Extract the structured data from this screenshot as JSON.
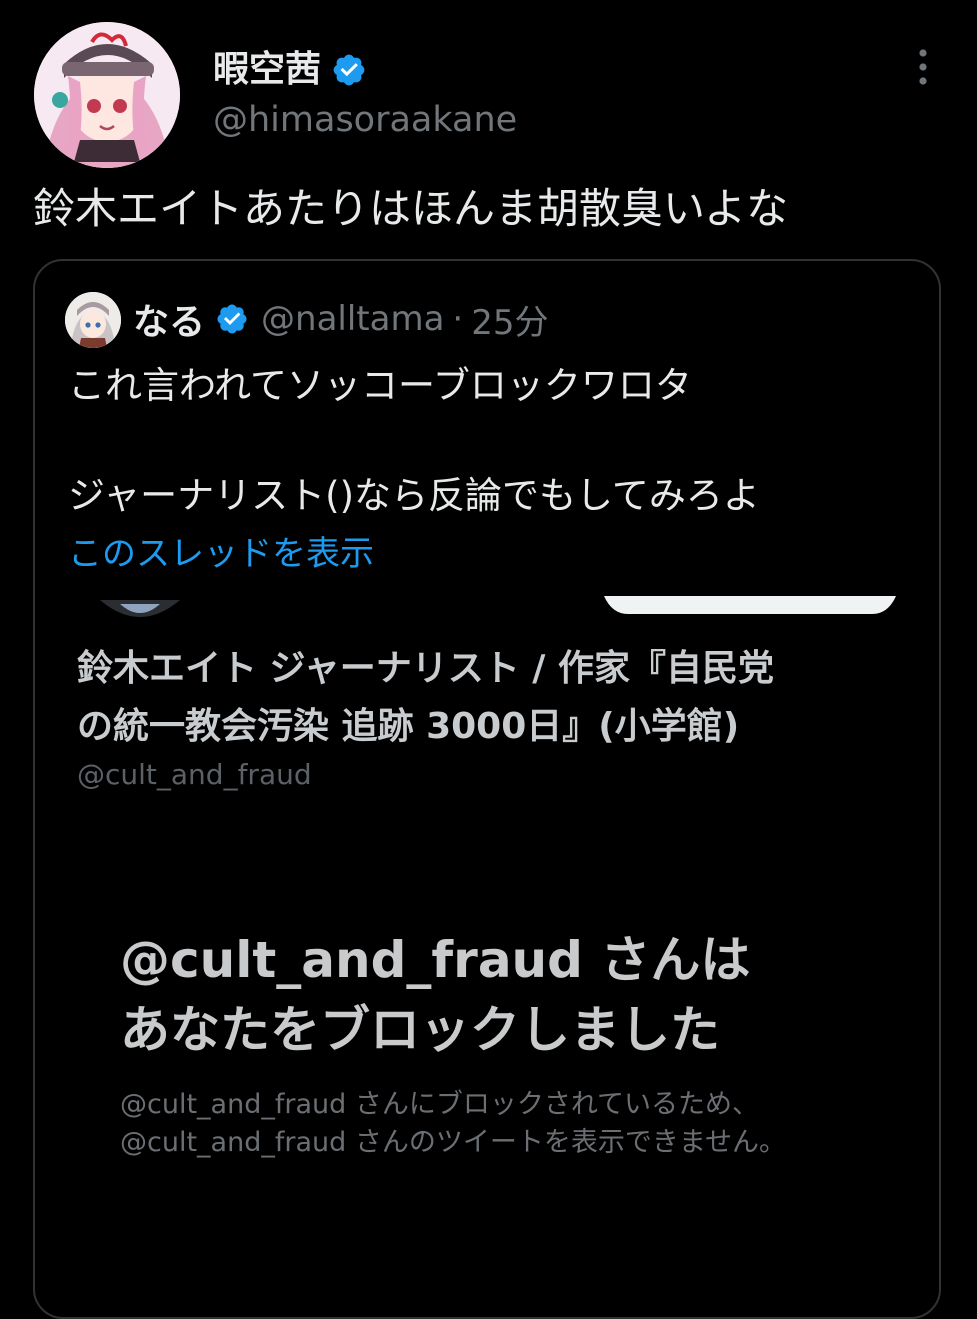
{
  "tweet": {
    "author": {
      "display_name": "暇空茜",
      "handle": "@himasoraakane",
      "verified": true
    },
    "text": "鈴木エイトあたりはほんま胡散臭いよな",
    "more_icon": "more-vertical-icon"
  },
  "quoted_tweet": {
    "author": {
      "display_name": "なる",
      "handle": "@nalltama",
      "separator": "·",
      "time": "25分",
      "verified": true
    },
    "lines": [
      "これ言われてソッコーブロックワロタ",
      "ジャーナリスト()なら反論でもしてみろよ"
    ],
    "show_thread": "このスレッドを表示"
  },
  "embedded_screenshot": {
    "profile_name_lines": [
      "鈴木エイト ジャーナリスト / 作家『自民党",
      "の統一教会汚染 追跡 3000日』(小学館)"
    ],
    "profile_handle": "@cult_and_fraud",
    "blocked_title_lines": [
      "@cult_and_fraud さんは",
      "あなたをブロックしました"
    ],
    "blocked_desc_lines": [
      "@cult_and_fraud さんにブロックされているため、",
      "@cult_and_fraud さんのツイートを表示できません。"
    ]
  },
  "colors": {
    "background": "#000000",
    "text_primary": "#e7e9ea",
    "text_secondary": "#71767b",
    "link": "#1d9bf0",
    "verified": "#1d9bf0",
    "card_border": "#2f3336"
  }
}
